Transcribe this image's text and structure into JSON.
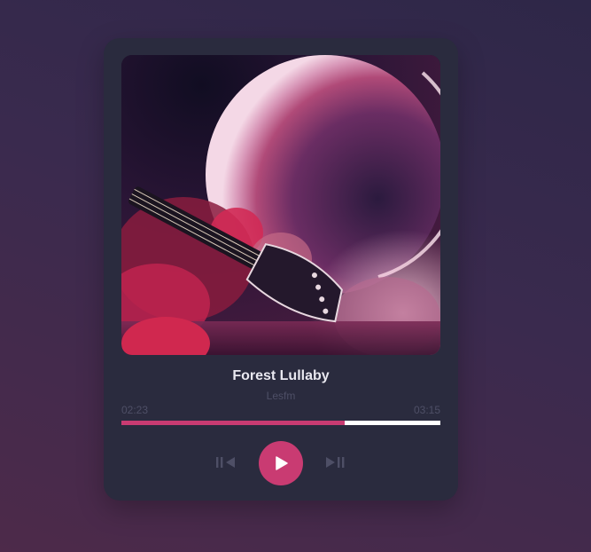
{
  "track": {
    "title": "Forest Lullaby",
    "artist": "Lesfm"
  },
  "playback": {
    "current_time": "02:23",
    "duration": "03:15",
    "progress_fraction": 0.7
  },
  "controls": {
    "previous_icon": "skip-previous-icon",
    "play_icon": "play-icon",
    "next_icon": "skip-next-icon"
  },
  "colors": {
    "accent": "#c93b72",
    "card": "#2a2b3e",
    "muted_text": "#4e4f66",
    "title_text": "#e9e8f0",
    "control_icon": "#4e4f66"
  }
}
